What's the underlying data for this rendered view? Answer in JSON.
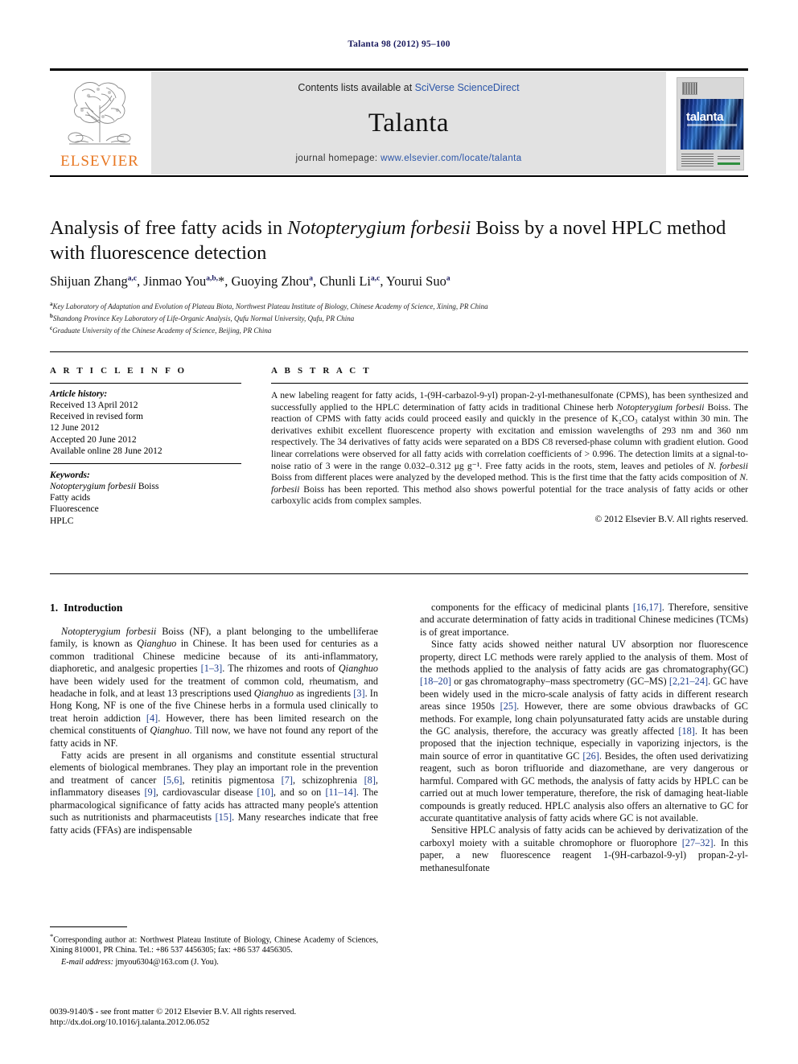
{
  "running_head": "Talanta 98 (2012) 95–100",
  "masthead": {
    "contents_prefix": "Contents lists available at ",
    "contents_link": "SciVerse ScienceDirect",
    "journal_title": "Talanta",
    "homepage_prefix": "journal homepage: ",
    "homepage_url": "www.elsevier.com/locate/talanta",
    "publisher_wordmark": "ELSEVIER",
    "cover_title": "talanta"
  },
  "article": {
    "title_part1": "Analysis of free fatty acids in ",
    "title_italic": "Notopterygium forbesii",
    "title_part2": " Boiss by a novel HPLC method with fluorescence detection",
    "authors": [
      {
        "name": "Shijuan Zhang",
        "sup": "a,c",
        "sep": ", "
      },
      {
        "name": "Jinmao You",
        "sup": "a,b,",
        "star": "*",
        "sep": ", "
      },
      {
        "name": "Guoying Zhou",
        "sup": "a",
        "sep": ", "
      },
      {
        "name": "Chunli Li",
        "sup": "a,c",
        "sep": ", "
      },
      {
        "name": "Yourui Suo",
        "sup": "a",
        "sep": ""
      }
    ],
    "affiliations": [
      {
        "marker": "a",
        "text": "Key Laboratory of Adaptation and Evolution of Plateau Biota, Northwest Plateau Institute of Biology, Chinese Academy of Science, Xining, PR China"
      },
      {
        "marker": "b",
        "text": "Shandong Province Key Laboratory of Life-Organic Analysis, Qufu Normal University, Qufu, PR China"
      },
      {
        "marker": "c",
        "text": "Graduate University of the Chinese Academy of Science, Beijing, PR China"
      }
    ]
  },
  "article_info": {
    "heading": "A R T I C L E   I N F O",
    "history_label": "Article history:",
    "history": [
      "Received 13 April 2012",
      "Received in revised form",
      "12 June 2012",
      "Accepted 20 June 2012",
      "Available online 28 June 2012"
    ],
    "keywords_label": "Keywords:",
    "keywords": [
      {
        "text": "Notopterygium forbesii",
        "italic": true,
        "suffix": " Boiss"
      },
      {
        "text": "Fatty acids",
        "italic": false,
        "suffix": ""
      },
      {
        "text": "Fluorescence",
        "italic": false,
        "suffix": ""
      },
      {
        "text": "HPLC",
        "italic": false,
        "suffix": ""
      }
    ]
  },
  "abstract": {
    "heading": "A B S T R A C T",
    "p1": "A new labeling reagent for fatty acids, 1-(9H-carbazol-9-yl) propan-2-yl-methanesulfonate (CPMS), has been synthesized and successfully applied to the HPLC determination of fatty acids in traditional Chinese herb ",
    "species1": "Notopterygium forbesii",
    "p2": " Boiss. The reaction of CPMS with fatty acids could proceed easily and quickly in the presence of K₂CO₃ catalyst within 30 min. The derivatives exhibit excellent fluorescence property with excitation and emission wavelengths of 293 nm and 360 nm respectively. The 34 derivatives of fatty acids were separated on a BDS C8 reversed-phase column with gradient elution. Good linear correlations were observed for all fatty acids with correlation coefficients of > 0.996. The detection limits at a signal-to-noise ratio of 3 were in the range 0.032–0.312 μg g⁻¹. Free fatty acids in the roots, stem, leaves and petioles of ",
    "species2": "N. forbesii",
    "p3": " Boiss from different places were analyzed by the developed method. This is the first time that the fatty acids composition of ",
    "species3": "N. forbesii",
    "p4": " Boiss has been reported. This method also shows powerful potential for the trace analysis of fatty acids or other carboxylic acids from complex samples.",
    "copyright": "© 2012 Elsevier B.V. All rights reserved."
  },
  "body": {
    "section_number": "1.",
    "section_title": "Introduction",
    "left_paragraphs": [
      "Notopterygium forbesii Boiss (NF), a plant belonging to the umbelliferae family, is known as Qianghuo in Chinese. It has been used for centuries as a common traditional Chinese medicine because of its anti-inflammatory, diaphoretic, and analgesic properties [1–3]. The rhizomes and roots of Qianghuo have been widely used for the treatment of common cold, rheumatism, and headache in folk, and at least 13 prescriptions used Qianghuo as ingredients [3]. In Hong Kong, NF is one of the five Chinese herbs in a formula used clinically to treat heroin addiction [4]. However, there has been limited research on the chemical constituents of Qianghuo. Till now, we have not found any report of the fatty acids in NF.",
      "Fatty acids are present in all organisms and constitute essential structural elements of biological membranes. They play an important role in the prevention and treatment of cancer [5,6], retinitis pigmentosa [7], schizophrenia [8], inflammatory diseases [9], cardiovascular disease [10], and so on [11–14]. The pharmacological significance of fatty acids has attracted many people's attention such as nutritionists and pharmaceutists [15]. Many researches indicate that free fatty acids (FFAs) are indispensable"
    ],
    "right_paragraphs": [
      "components for the efficacy of medicinal plants [16,17]. Therefore, sensitive and accurate determination of fatty acids in traditional Chinese medicines (TCMs) is of great importance.",
      "Since fatty acids showed neither natural UV absorption nor fluorescence property, direct LC methods were rarely applied to the analysis of them. Most of the methods applied to the analysis of fatty acids are gas chromatography(GC) [18–20] or gas chromatography–mass spectrometry (GC–MS) [2,21–24]. GC have been widely used in the micro-scale analysis of fatty acids in different research areas since 1950s [25]. However, there are some obvious drawbacks of GC methods. For example, long chain polyunsaturated fatty acids are unstable during the GC analysis, therefore, the accuracy was greatly affected [18]. It has been proposed that the injection technique, especially in vaporizing injectors, is the main source of error in quantitative GC [26]. Besides, the often used derivatizing reagent, such as boron trifluoride and diazomethane, are very dangerous or harmful. Compared with GC methods, the analysis of fatty acids by HPLC can be carried out at much lower temperature, therefore, the risk of damaging heat-liable compounds is greatly reduced. HPLC analysis also offers an alternative to GC for accurate quantitative analysis of fatty acids where GC is not available.",
      "Sensitive HPLC analysis of fatty acids can be achieved by derivatization of the carboxyl moiety with a suitable chromophore or fluorophore [27–32]. In this paper, a new fluorescence reagent 1-(9H-carbazol-9-yl) propan-2-yl-methanesulfonate"
    ]
  },
  "footnote": {
    "corresponding": "Corresponding author at: Northwest Plateau Institute of Biology, Chinese Academy of Sciences, Xining 810001, PR China. Tel.: +86 537 4456305; fax: +86 537 4456305.",
    "email_label": "E-mail address:",
    "email": "jmyou6304@163.com (J. You)."
  },
  "imprint": {
    "line1": "0039-9140/$ - see front matter © 2012 Elsevier B.V. All rights reserved.",
    "line2": "http://dx.doi.org/10.1016/j.talanta.2012.06.052"
  },
  "colors": {
    "link_blue": "#2b55a8",
    "ref_blue": "#1f3f8f",
    "elsevier_orange": "#E87722",
    "running_head": "#1a1a5e"
  }
}
